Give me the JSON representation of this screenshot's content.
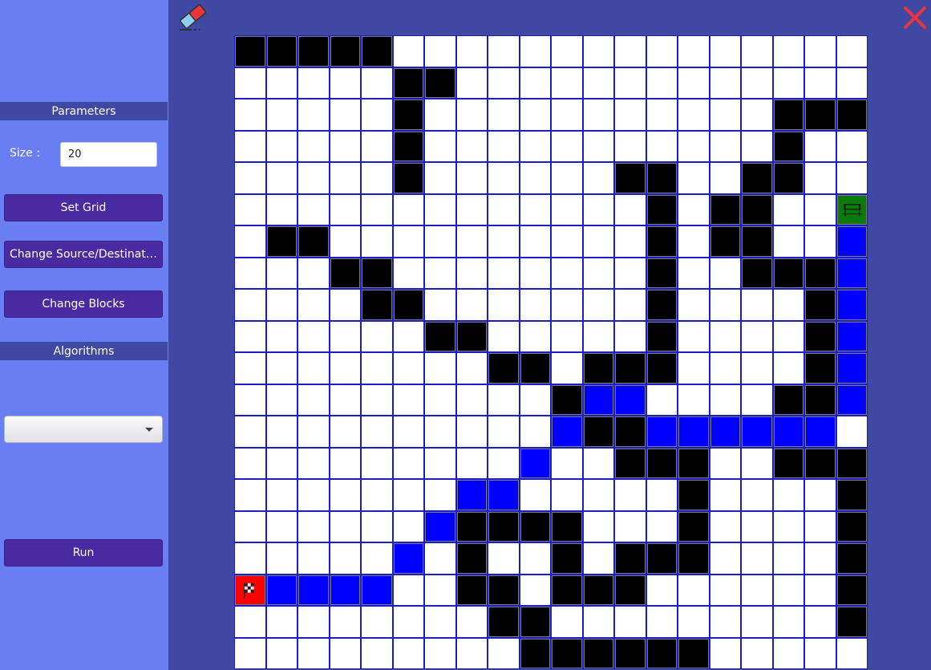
{
  "sidebar": {
    "parameters_header": "Parameters",
    "size_label": "Size :",
    "size_value": "20",
    "set_grid_label": "Set Grid",
    "change_source_dest_label": "Change Source/Destinati...",
    "change_blocks_label": "Change Blocks",
    "algorithms_header": "Algorithms",
    "algorithm_selected": "",
    "run_label": "Run"
  },
  "toolbar": {
    "eraser_icon": "eraser-icon",
    "close_icon": "close-icon"
  },
  "colors": {
    "sidebar_bg": "#6a7ef4",
    "canvas_bg": "#3f49a3",
    "button_bg": "#4a2aa0",
    "grid_line": "#1d1dc7",
    "block": "#000000",
    "path": "#0000ff",
    "source": "#ff0000",
    "destination": "#0a7a0a"
  },
  "grid": {
    "size": 20,
    "legend": {
      "0": "empty",
      "1": "block",
      "2": "path",
      "3": "source",
      "4": "destination"
    },
    "cells": [
      [
        1,
        1,
        1,
        1,
        1,
        0,
        0,
        0,
        0,
        0,
        0,
        0,
        0,
        0,
        0,
        0,
        0,
        0,
        0,
        0
      ],
      [
        0,
        0,
        0,
        0,
        0,
        1,
        1,
        0,
        0,
        0,
        0,
        0,
        0,
        0,
        0,
        0,
        0,
        0,
        0,
        0
      ],
      [
        0,
        0,
        0,
        0,
        0,
        1,
        0,
        0,
        0,
        0,
        0,
        0,
        0,
        0,
        0,
        0,
        0,
        1,
        1,
        1
      ],
      [
        0,
        0,
        0,
        0,
        0,
        1,
        0,
        0,
        0,
        0,
        0,
        0,
        0,
        0,
        0,
        0,
        0,
        1,
        0,
        0
      ],
      [
        0,
        0,
        0,
        0,
        0,
        1,
        0,
        0,
        0,
        0,
        0,
        0,
        1,
        1,
        0,
        0,
        1,
        1,
        0,
        0
      ],
      [
        0,
        0,
        0,
        0,
        0,
        0,
        0,
        0,
        0,
        0,
        0,
        0,
        0,
        1,
        0,
        1,
        1,
        0,
        0,
        4
      ],
      [
        0,
        1,
        1,
        0,
        0,
        0,
        0,
        0,
        0,
        0,
        0,
        0,
        0,
        1,
        0,
        1,
        1,
        0,
        0,
        2
      ],
      [
        0,
        0,
        0,
        1,
        1,
        0,
        0,
        0,
        0,
        0,
        0,
        0,
        0,
        1,
        0,
        0,
        1,
        1,
        1,
        2
      ],
      [
        0,
        0,
        0,
        0,
        1,
        1,
        0,
        0,
        0,
        0,
        0,
        0,
        0,
        1,
        0,
        0,
        0,
        0,
        1,
        2
      ],
      [
        0,
        0,
        0,
        0,
        0,
        0,
        1,
        1,
        0,
        0,
        0,
        0,
        0,
        1,
        0,
        0,
        0,
        0,
        1,
        2
      ],
      [
        0,
        0,
        0,
        0,
        0,
        0,
        0,
        0,
        1,
        1,
        0,
        1,
        1,
        1,
        0,
        0,
        0,
        0,
        1,
        2
      ],
      [
        0,
        0,
        0,
        0,
        0,
        0,
        0,
        0,
        0,
        0,
        1,
        2,
        2,
        0,
        0,
        0,
        0,
        1,
        1,
        2
      ],
      [
        0,
        0,
        0,
        0,
        0,
        0,
        0,
        0,
        0,
        0,
        2,
        1,
        1,
        2,
        2,
        2,
        2,
        2,
        2,
        0
      ],
      [
        0,
        0,
        0,
        0,
        0,
        0,
        0,
        0,
        0,
        2,
        0,
        0,
        1,
        1,
        1,
        0,
        0,
        1,
        1,
        1
      ],
      [
        0,
        0,
        0,
        0,
        0,
        0,
        0,
        2,
        2,
        0,
        0,
        0,
        0,
        0,
        1,
        0,
        0,
        0,
        0,
        1
      ],
      [
        0,
        0,
        0,
        0,
        0,
        0,
        2,
        1,
        1,
        1,
        1,
        0,
        0,
        0,
        1,
        0,
        0,
        0,
        0,
        1
      ],
      [
        0,
        0,
        0,
        0,
        0,
        2,
        0,
        1,
        0,
        0,
        1,
        0,
        1,
        1,
        1,
        0,
        0,
        0,
        0,
        1
      ],
      [
        3,
        2,
        2,
        2,
        2,
        0,
        0,
        1,
        1,
        0,
        1,
        1,
        1,
        0,
        0,
        0,
        0,
        0,
        0,
        1
      ],
      [
        0,
        0,
        0,
        0,
        0,
        0,
        0,
        0,
        1,
        1,
        0,
        0,
        0,
        0,
        0,
        0,
        0,
        0,
        0,
        1
      ],
      [
        0,
        0,
        0,
        0,
        0,
        0,
        0,
        0,
        0,
        1,
        1,
        1,
        1,
        1,
        1,
        0,
        0,
        0,
        0,
        0
      ]
    ]
  }
}
